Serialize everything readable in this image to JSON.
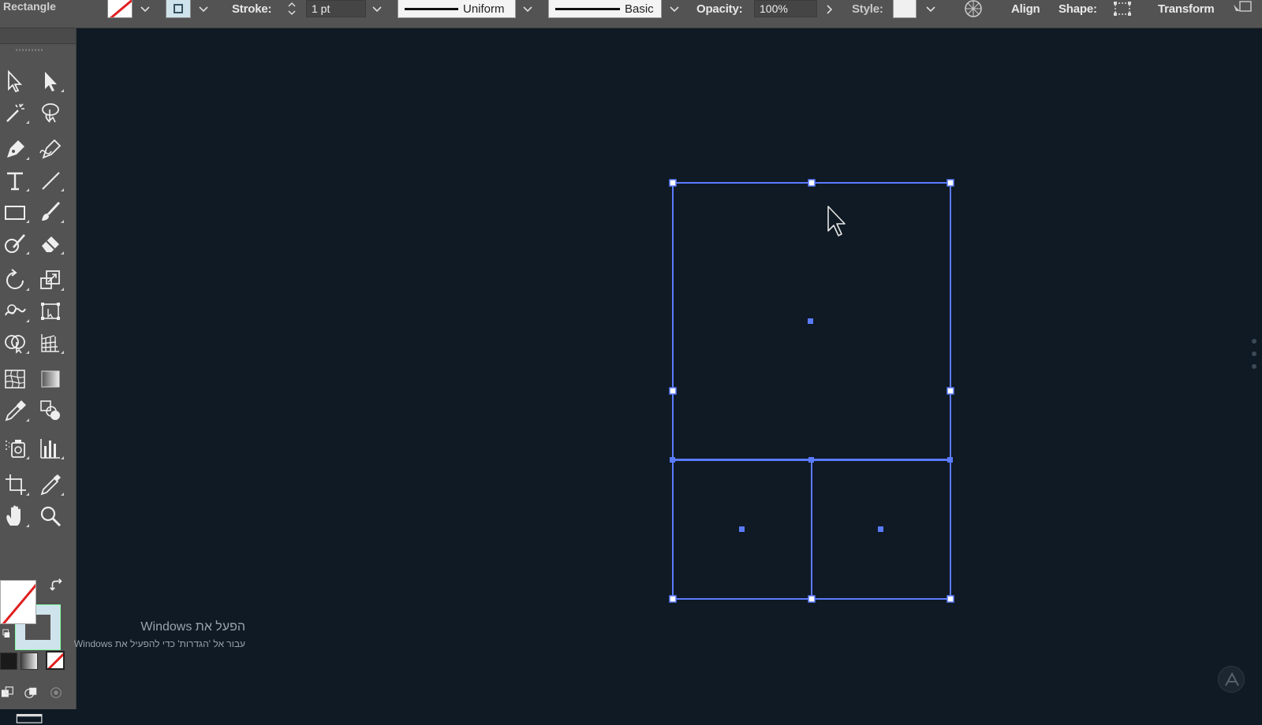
{
  "app": {
    "tool_name": "Rectangle"
  },
  "control_bar": {
    "stroke_label": "Stroke:",
    "stroke_weight": "1 pt",
    "profile": "Uniform",
    "brush": "Basic",
    "opacity_label": "Opacity:",
    "opacity_value": "100%",
    "style_label": "Style:",
    "align_label": "Align",
    "shape_label": "Shape:",
    "transform_label": "Transform"
  },
  "colors": {
    "selection": "#5b7bff",
    "canvas": "#0f1a24",
    "panel": "#535353",
    "none_slash": "#e02020"
  },
  "icons": {
    "tools": [
      "selection-tool",
      "direct-selection-tool",
      "magic-wand-tool",
      "lasso-tool",
      "pen-tool",
      "curvature-tool",
      "type-tool",
      "line-segment-tool",
      "rectangle-tool",
      "paintbrush-tool",
      "shaper-tool",
      "eraser-tool",
      "rotate-tool",
      "scale-tool",
      "warp-tool",
      "free-transform-tool",
      "shape-builder-tool",
      "perspective-grid-tool",
      "mesh-tool",
      "gradient-tool",
      "eyedropper-tool",
      "blend-tool",
      "symbol-sprayer-tool",
      "column-graph-tool",
      "artboard-tool",
      "slice-tool",
      "hand-tool",
      "zoom-tool"
    ]
  },
  "watermark": {
    "title": "הפעל את Windows",
    "subtitle": "עבור אל 'הגדרות' כדי להפעיל את Windows"
  }
}
